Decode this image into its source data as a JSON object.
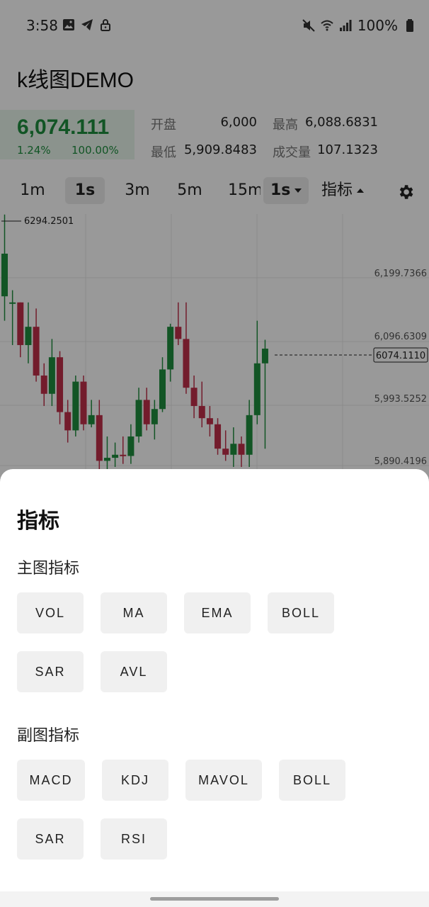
{
  "status_bar": {
    "time": "3:58",
    "battery": "100%",
    "left_icons": [
      "image-icon",
      "telegram-icon",
      "lock-icon"
    ],
    "right_icons": [
      "mute-icon",
      "wifi-icon",
      "signal-icon",
      "battery-icon"
    ]
  },
  "app_bar": {
    "title": "k线图DEMO"
  },
  "ticker": {
    "price": "6,074.111",
    "change_pct": "1.24%",
    "ratio_pct": "100.00%",
    "stats": [
      {
        "label": "开盘",
        "value": "6,000"
      },
      {
        "label": "最高",
        "value": "6,088.6831"
      },
      {
        "label": "最低",
        "value": "5,909.8483"
      },
      {
        "label": "成交量",
        "value": "107.1323"
      }
    ],
    "accent_color": "#1e8e3e"
  },
  "interval_bar": {
    "intervals": [
      "1m",
      "1s",
      "3m",
      "5m",
      "15m"
    ],
    "active_interval": "1s",
    "selector_value": "1s",
    "indicator_label": "指标"
  },
  "chart_data": {
    "type": "candlestick",
    "y_tick_labels": [
      "6,199.7366",
      "6,096.6309",
      "5,993.5252",
      "5,890.4196"
    ],
    "high_label": "6294.2501",
    "current_price_label": "6074.1110",
    "up_color": "#1e8e3e",
    "down_color": "#c0304a",
    "candles": [
      {
        "o": 6160,
        "c": 6230,
        "h": 6294.25,
        "l": 6120
      },
      {
        "o": 6150,
        "c": 6150,
        "h": 6170,
        "l": 6080
      },
      {
        "o": 6150,
        "c": 6080,
        "h": 6150,
        "l": 6060
      },
      {
        "o": 6080,
        "c": 6110,
        "h": 6150,
        "l": 6050
      },
      {
        "o": 6110,
        "c": 6030,
        "h": 6140,
        "l": 6020
      },
      {
        "o": 6030,
        "c": 6000,
        "h": 6050,
        "l": 5980
      },
      {
        "o": 6000,
        "c": 6060,
        "h": 6090,
        "l": 5980
      },
      {
        "o": 6060,
        "c": 5970,
        "h": 6070,
        "l": 5950
      },
      {
        "o": 5970,
        "c": 5940,
        "h": 5990,
        "l": 5920
      },
      {
        "o": 5940,
        "c": 6020,
        "h": 6030,
        "l": 5930
      },
      {
        "o": 6020,
        "c": 5950,
        "h": 6030,
        "l": 5940
      },
      {
        "o": 5950,
        "c": 5965,
        "h": 5990,
        "l": 5945
      },
      {
        "o": 5965,
        "c": 5890,
        "h": 5990,
        "l": 5860
      },
      {
        "o": 5890,
        "c": 5895,
        "h": 5930,
        "l": 5870
      },
      {
        "o": 5895,
        "c": 5900,
        "h": 5920,
        "l": 5880
      },
      {
        "o": 5900,
        "c": 5898,
        "h": 5930,
        "l": 5885
      },
      {
        "o": 5898,
        "c": 5930,
        "h": 5950,
        "l": 5885
      },
      {
        "o": 5930,
        "c": 5990,
        "h": 6010,
        "l": 5920
      },
      {
        "o": 5990,
        "c": 5950,
        "h": 6010,
        "l": 5940
      },
      {
        "o": 5950,
        "c": 5975,
        "h": 5990,
        "l": 5925
      },
      {
        "o": 5975,
        "c": 6040,
        "h": 6060,
        "l": 5970
      },
      {
        "o": 6040,
        "c": 6110,
        "h": 6115,
        "l": 6020
      },
      {
        "o": 6110,
        "c": 6090,
        "h": 6150,
        "l": 6080
      },
      {
        "o": 6090,
        "c": 6010,
        "h": 6150,
        "l": 6000
      },
      {
        "o": 6010,
        "c": 5980,
        "h": 6030,
        "l": 5960
      },
      {
        "o": 5980,
        "c": 5960,
        "h": 6020,
        "l": 5945
      },
      {
        "o": 5960,
        "c": 5950,
        "h": 5980,
        "l": 5930
      },
      {
        "o": 5950,
        "c": 5910,
        "h": 5960,
        "l": 5900
      },
      {
        "o": 5910,
        "c": 5900,
        "h": 5940,
        "l": 5890
      },
      {
        "o": 5900,
        "c": 5918,
        "h": 5945,
        "l": 5880
      },
      {
        "o": 5918,
        "c": 5900,
        "h": 5930,
        "l": 5880
      },
      {
        "o": 5900,
        "c": 5965,
        "h": 5990,
        "l": 5880
      },
      {
        "o": 5965,
        "c": 6050,
        "h": 6120,
        "l": 5950
      },
      {
        "o": 6050,
        "c": 6074.111,
        "h": 6088.68,
        "l": 5909.85
      }
    ]
  },
  "sheet": {
    "title": "指标",
    "main_section_title": "主图指标",
    "main_indicators": [
      "VOL",
      "MA",
      "EMA",
      "BOLL",
      "SAR",
      "AVL"
    ],
    "sub_section_title": "副图指标",
    "sub_indicators": [
      "MACD",
      "KDJ",
      "MAVOL",
      "BOLL",
      "SAR",
      "RSI"
    ]
  }
}
